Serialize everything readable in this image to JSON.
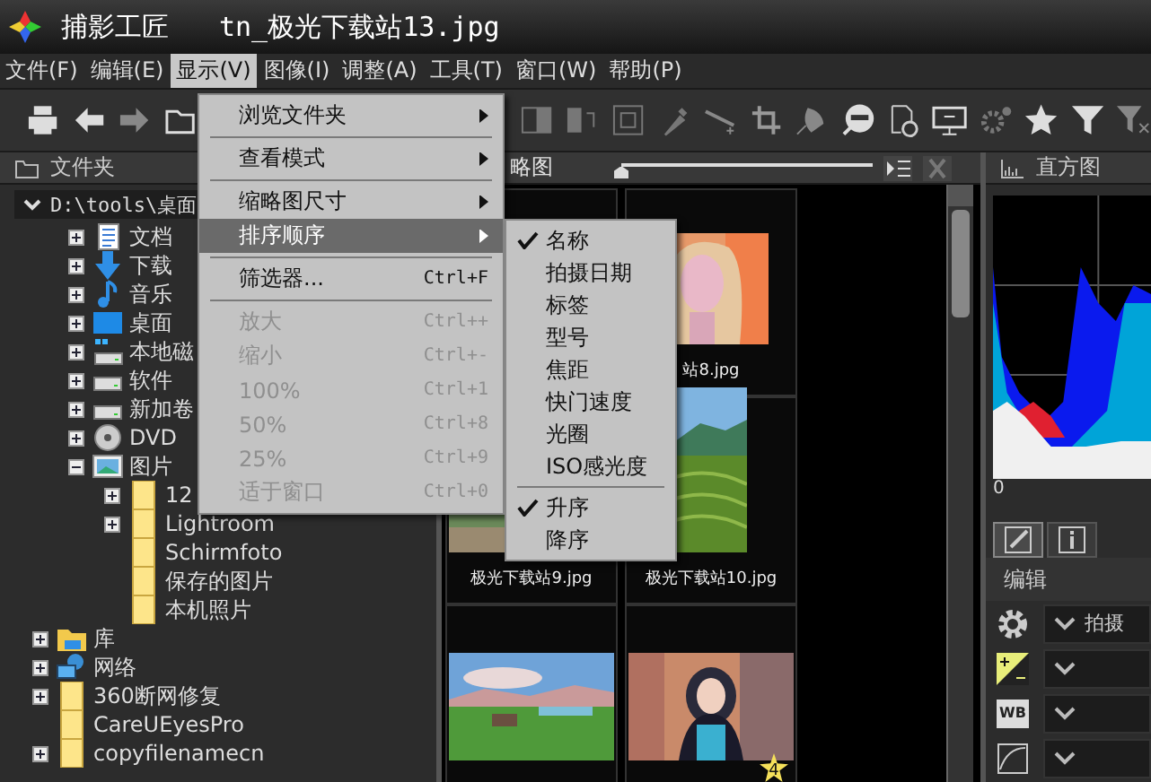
{
  "window": {
    "app_name": "捕影工匠",
    "file_name": "tn_极光下载站13.jpg"
  },
  "menubar": [
    {
      "label": "文件(F)",
      "selected": false
    },
    {
      "label": "编辑(E)",
      "selected": false
    },
    {
      "label": "显示(V)",
      "selected": true
    },
    {
      "label": "图像(I)",
      "selected": false
    },
    {
      "label": "调整(A)",
      "selected": false
    },
    {
      "label": "工具(T)",
      "selected": false
    },
    {
      "label": "窗口(W)",
      "selected": false
    },
    {
      "label": "帮助(P)",
      "selected": false
    }
  ],
  "folder_panel": {
    "title": "文件夹",
    "path": "D:\\tools\\桌面",
    "tree": [
      {
        "children": [
          {
            "label": "文档",
            "kind": "document",
            "expanded": false
          },
          {
            "label": "下载",
            "kind": "download",
            "expanded": false
          },
          {
            "label": "音乐",
            "kind": "music",
            "expanded": false
          },
          {
            "label": "桌面",
            "kind": "desktop",
            "expanded": false
          },
          {
            "label": "本地磁",
            "kind": "system-drive",
            "expanded": false
          },
          {
            "label": "软件",
            "kind": "drive",
            "expanded": false
          },
          {
            "label": "新加卷",
            "kind": "drive",
            "expanded": false
          },
          {
            "label": "DVD",
            "kind": "disc",
            "expanded": false
          },
          {
            "label": "图片",
            "kind": "pictures",
            "expanded": true,
            "children": [
              {
                "label": "12",
                "kind": "folder",
                "expanded": false
              },
              {
                "label": "Lightroom",
                "kind": "folder",
                "expanded": false
              },
              {
                "label": "Schirmfoto",
                "kind": "folder"
              },
              {
                "label": "保存的图片",
                "kind": "folder"
              },
              {
                "label": "本机照片",
                "kind": "folder"
              }
            ]
          }
        ]
      },
      {
        "label": "库",
        "kind": "library",
        "expanded": false
      },
      {
        "label": "网络",
        "kind": "network",
        "expanded": false
      },
      {
        "label": "360断网修复",
        "kind": "folder",
        "expanded": false
      },
      {
        "label": "CareUEyesPro",
        "kind": "folder"
      },
      {
        "label": "copyfilenamecn",
        "kind": "folder",
        "expanded": false
      }
    ]
  },
  "thumbnail_panel": {
    "title": "略图",
    "size_slider": {
      "level": 0
    },
    "thumbnails": [
      {
        "kind": "blank"
      },
      {
        "kind": "woman",
        "caption": "站8.jpg"
      },
      {
        "kind": "valley",
        "caption": "极光下载站9.jpg"
      },
      {
        "kind": "terraces",
        "caption": "极光下载站10.jpg"
      },
      {
        "kind": "lake"
      },
      {
        "kind": "girl",
        "rating": "4"
      }
    ]
  },
  "histogram_panel": {
    "title": "直方图",
    "axis_label": "0"
  },
  "edit_panel": {
    "tabs": [
      {
        "kind": "edit",
        "selected": true
      },
      {
        "kind": "info",
        "selected": false
      }
    ],
    "title": "编辑",
    "rows": [
      {
        "kind": "settings",
        "value": "拍摄"
      },
      {
        "kind": "exposure"
      },
      {
        "kind": "white-balance",
        "icon_text": "WB"
      },
      {
        "kind": "tone"
      }
    ]
  },
  "display_menu": [
    {
      "kind": "item",
      "label": "浏览文件夹",
      "submenu": true,
      "selected": false,
      "disabled": false
    },
    {
      "kind": "separator"
    },
    {
      "kind": "item",
      "label": "查看模式",
      "submenu": true,
      "selected": false,
      "disabled": false
    },
    {
      "kind": "separator"
    },
    {
      "kind": "item",
      "label": "缩略图尺寸",
      "submenu": true,
      "selected": false,
      "disabled": false
    },
    {
      "kind": "item",
      "label": "排序顺序",
      "submenu": true,
      "selected": true,
      "disabled": false
    },
    {
      "kind": "separator"
    },
    {
      "kind": "item",
      "label": "筛选器...",
      "shortcut": "Ctrl+F",
      "selected": false,
      "disabled": false
    },
    {
      "kind": "separator"
    },
    {
      "kind": "item",
      "label": "放大",
      "shortcut": "Ctrl++",
      "selected": false,
      "disabled": true
    },
    {
      "kind": "item",
      "label": "缩小",
      "shortcut": "Ctrl+-",
      "selected": false,
      "disabled": true
    },
    {
      "kind": "item",
      "label": "100%",
      "shortcut": "Ctrl+1",
      "selected": false,
      "disabled": true
    },
    {
      "kind": "item",
      "label": "50%",
      "shortcut": "Ctrl+8",
      "selected": false,
      "disabled": true
    },
    {
      "kind": "item",
      "label": "25%",
      "shortcut": "Ctrl+9",
      "selected": false,
      "disabled": true
    },
    {
      "kind": "item",
      "label": "适于窗口",
      "shortcut": "Ctrl+0",
      "selected": false,
      "disabled": true
    }
  ],
  "sort_menu": [
    {
      "kind": "item",
      "label": "名称",
      "checked": true
    },
    {
      "kind": "item",
      "label": "拍摄日期",
      "checked": false
    },
    {
      "kind": "item",
      "label": "标签",
      "checked": false
    },
    {
      "kind": "item",
      "label": "型号",
      "checked": false
    },
    {
      "kind": "item",
      "label": "焦距",
      "checked": false
    },
    {
      "kind": "item",
      "label": "快门速度",
      "checked": false
    },
    {
      "kind": "item",
      "label": "光圈",
      "checked": false
    },
    {
      "kind": "item",
      "label": "ISO感光度",
      "checked": false
    },
    {
      "kind": "separator"
    },
    {
      "kind": "item",
      "label": "升序",
      "checked": true
    },
    {
      "kind": "item",
      "label": "降序",
      "checked": false
    }
  ]
}
